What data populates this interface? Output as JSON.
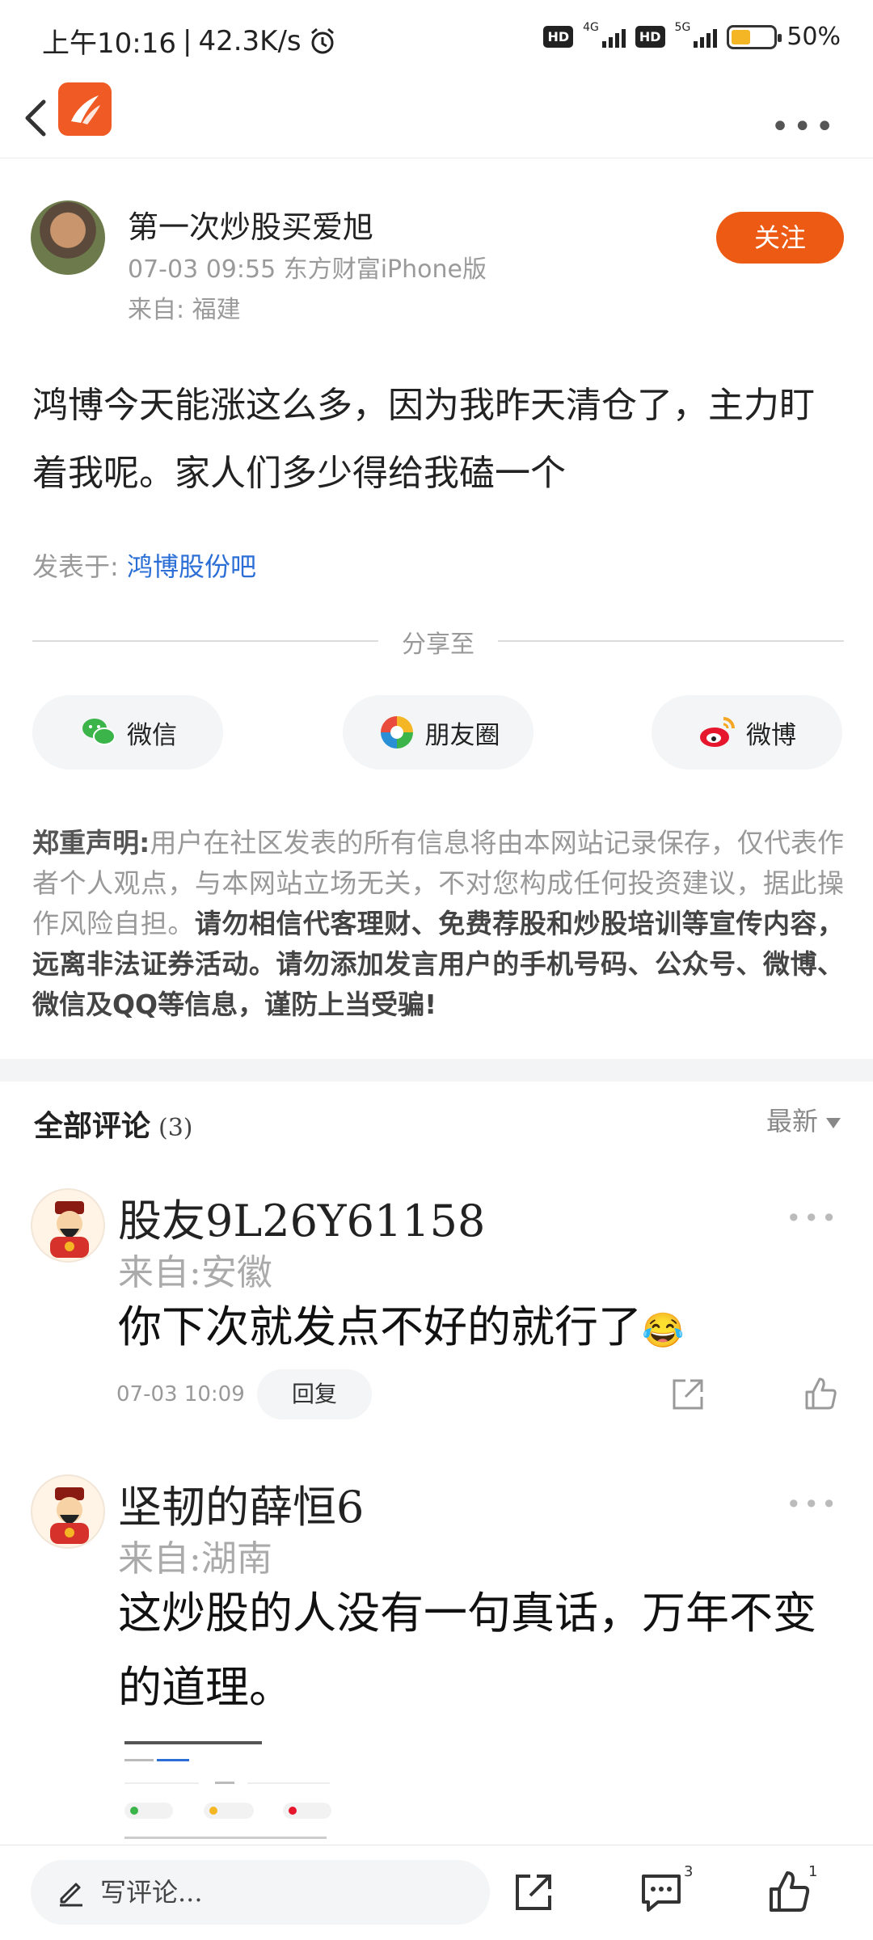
{
  "status_bar": {
    "time": "上午10:16",
    "net_speed": "42.3K/s",
    "hd1": "HD",
    "net1": "4G",
    "hd2": "HD",
    "net2": "5G",
    "battery": "50%"
  },
  "nav": {
    "back_icon": "chevron-left-icon",
    "logo_icon": "app-logo-icon",
    "more_icon": "more-dots-icon"
  },
  "author": {
    "name": "第一次炒股买爱旭",
    "meta": "07-03 09:55  东方财富iPhone版",
    "from": "来自: 福建",
    "follow_label": "关注"
  },
  "post": {
    "body": "鸿博今天能涨这么多，因为我昨天清仓了，主力盯着我呢。家人们多少得给我磕一个",
    "posted_in_label": "发表于: ",
    "posted_in_link": "鸿博股份吧"
  },
  "share": {
    "divider_label": "分享至",
    "wechat": "微信",
    "moments": "朋友圈",
    "weibo": "微博"
  },
  "disclaimer": {
    "heading": "郑重声明:",
    "normal": "用户在社区发表的所有信息将由本网站记录保存，仅代表作者个人观点，与本网站立场无关，不对您构成任何投资建议，据此操作风险自担。",
    "strong": "请勿相信代客理财、免费荐股和炒股培训等宣传内容，远离非法证券活动。请勿添加发言用户的手机号码、公众号、微博、微信及QQ等信息，谨防上当受骗!"
  },
  "comments_header": {
    "title": "全部评论",
    "count": "(3)",
    "sort": "最新"
  },
  "comments": [
    {
      "name": "股友9L26Y61158",
      "from": "来自:安徽",
      "text": "你下次就发点不好的就行了",
      "emoji": "😂",
      "time": "07-03 10:09",
      "reply_label": "回复"
    },
    {
      "name": "坚韧的薛恒6",
      "from": "来自:湖南",
      "text": "这炒股的人没有一句真话，万年不变的道理。"
    }
  ],
  "bottom_bar": {
    "write_placeholder": "写评论...",
    "comment_count": "3",
    "like_count": "1"
  },
  "colors": {
    "accent": "#ec5a13",
    "link": "#2b6fd6",
    "battery": "#f4b625"
  }
}
